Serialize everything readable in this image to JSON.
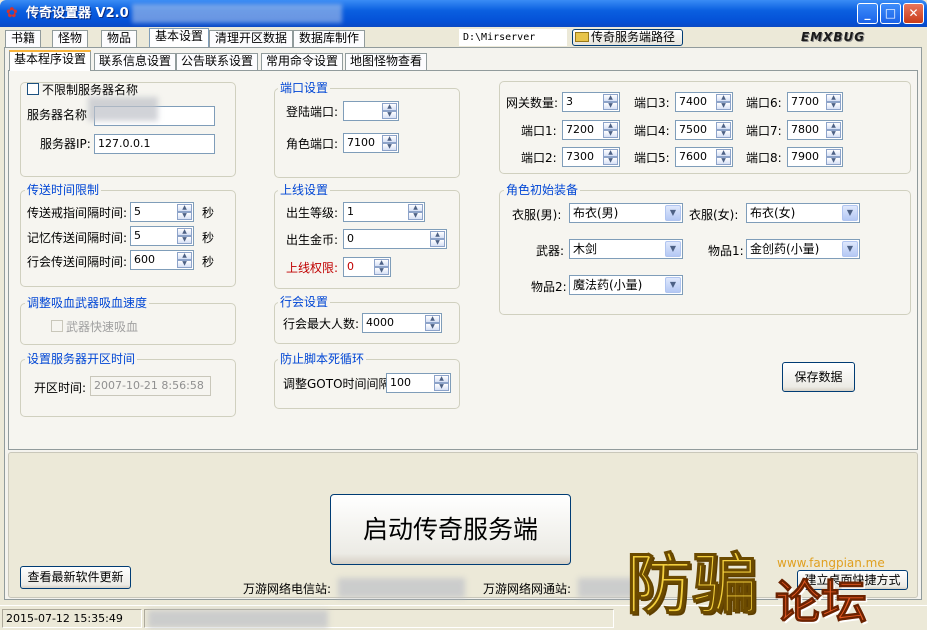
{
  "window": {
    "title": "传奇设置器 V2.0",
    "app_icon": "gear-cog-icon",
    "minimize": "_",
    "maximize": "□",
    "close": "✕"
  },
  "top_tabs": [
    "书籍",
    "怪物",
    "物品",
    "基本设置",
    "清理开区数据",
    "数据库制作"
  ],
  "toolbar": {
    "server_path": "D:\\Mirserver",
    "path_button": "传奇服务端路径",
    "logo_text": "EMXBUG"
  },
  "sub_tabs": [
    "基本程序设置",
    "联系信息设置",
    "公告联系设置",
    "常用命令设置",
    "地图怪物查看"
  ],
  "server": {
    "unlimited_name_label": "不限制服务器名称",
    "name_label": "服务器名称",
    "ip_label": "服务器IP:",
    "ip_value": "127.0.0.1"
  },
  "ports": {
    "title": "端口设置",
    "login_label": "登陆端口:",
    "login_value": "",
    "role_label": "角色端口:",
    "role_value": "7100"
  },
  "gateway": {
    "count_label": "网关数量:",
    "count_value": "3",
    "ports": [
      {
        "label": "端口1:",
        "value": "7200"
      },
      {
        "label": "端口2:",
        "value": "7300"
      },
      {
        "label": "端口3:",
        "value": "7400"
      },
      {
        "label": "端口4:",
        "value": "7500"
      },
      {
        "label": "端口5:",
        "value": "7600"
      },
      {
        "label": "端口6:",
        "value": "7700"
      },
      {
        "label": "端口7:",
        "value": "7800"
      },
      {
        "label": "端口8:",
        "value": "7900"
      }
    ]
  },
  "teleport": {
    "title": "传送时间限制",
    "ring_label": "传送戒指间隔时间:",
    "ring_value": "5",
    "memory_label": "记忆传送间隔时间:",
    "memory_value": "5",
    "guild_label": "行会传送间隔时间:",
    "guild_value": "600",
    "unit": "秒"
  },
  "online": {
    "title": "上线设置",
    "level_label": "出生等级:",
    "level_value": "1",
    "gold_label": "出生金币:",
    "gold_value": "0",
    "perm_label": "上线权限:",
    "perm_value": "0"
  },
  "equip": {
    "title": "角色初始装备",
    "cloth_m_label": "衣服(男):",
    "cloth_m_value": "布衣(男)",
    "cloth_f_label": "衣服(女):",
    "cloth_f_value": "布衣(女)",
    "weapon_label": "武器:",
    "weapon_value": "木剑",
    "item1_label": "物品1:",
    "item1_value": "金创药(小量)",
    "item2_label": "物品2:",
    "item2_value": "魔法药(小量)"
  },
  "vampire": {
    "title": "调整吸血武器吸血速度",
    "check_label": "武器快速吸血"
  },
  "guild": {
    "title": "行会设置",
    "max_label": "行会最大人数:",
    "max_value": "4000"
  },
  "open_time": {
    "title": "设置服务器开区时间",
    "label": "开区时间:",
    "value": "2007-10-21  8:56:58"
  },
  "anti_loop": {
    "title": "防止脚本死循环",
    "label": "调整GOTO时间间隔:",
    "value": "100"
  },
  "buttons": {
    "save": "保存数据",
    "start": "启动传奇服务端",
    "update": "查看最新软件更新",
    "shortcut": "建立桌面快捷方式"
  },
  "links": {
    "telecom": "万游网络电信站:",
    "netcom": "万游网络网通站:"
  },
  "status": {
    "datetime": "2015-07-12  15:35:49"
  },
  "watermark": {
    "url": "www.fangpian.me",
    "big1": "防骗",
    "big2": "论坛"
  }
}
